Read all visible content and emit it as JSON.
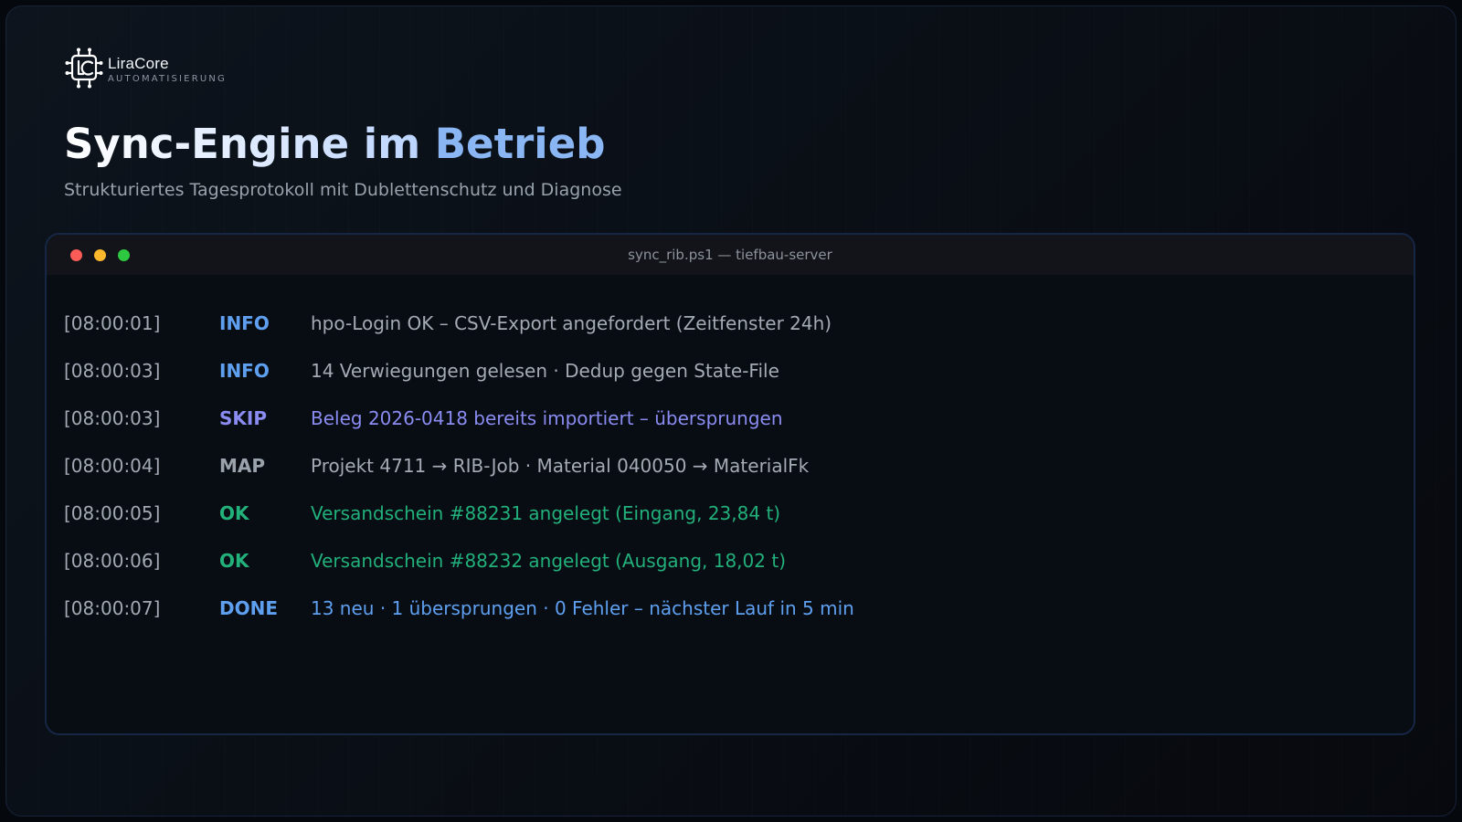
{
  "brand": {
    "name": "LiraCore",
    "tagline": "AUTOMATISIERUNG",
    "logo_icon": "lc-circuit-logo-icon"
  },
  "header": {
    "title_part1": "Sync-Engine im ",
    "title_part2": "Betrieb",
    "subtitle": "Strukturiertes Tagesprotokoll mit Dublettenschutz und Diagnose"
  },
  "terminal": {
    "window_title": "sync_rib.ps1 — tiefbau-server",
    "controls": [
      "close-dot",
      "minimize-dot",
      "maximize-dot"
    ],
    "rows": [
      {
        "time": "[08:00:01]",
        "level": "INFO",
        "message": "hpo-Login OK – CSV-Export angefordert (Zeitfenster 24h)"
      },
      {
        "time": "[08:00:03]",
        "level": "INFO",
        "message": "14 Verwiegungen gelesen · Dedup gegen State-File"
      },
      {
        "time": "[08:00:03]",
        "level": "SKIP",
        "message": "Beleg 2026-0418 bereits importiert – übersprungen"
      },
      {
        "time": "[08:00:04]",
        "level": "MAP",
        "message": "Projekt 4711 → RIB-Job · Material 040050 → MaterialFk"
      },
      {
        "time": "[08:00:05]",
        "level": "OK",
        "message": "Versandschein #88231 angelegt (Eingang, 23,84 t)"
      },
      {
        "time": "[08:00:06]",
        "level": "OK",
        "message": "Versandschein #88232 angelegt (Ausgang, 18,02 t)"
      },
      {
        "time": "[08:00:07]",
        "level": "DONE",
        "message": "13 neu · 1 übersprungen · 0 Fehler – nächster Lauf in 5 min"
      }
    ]
  },
  "colors": {
    "accent": "#8ab6f4",
    "info": "#5ea0ef",
    "skip": "#8a8cf1",
    "ok": "#22b07b",
    "map": "#9aa2ac",
    "close": "#fb5c58",
    "minimize": "#fcb82c",
    "maximize": "#2ec840"
  }
}
